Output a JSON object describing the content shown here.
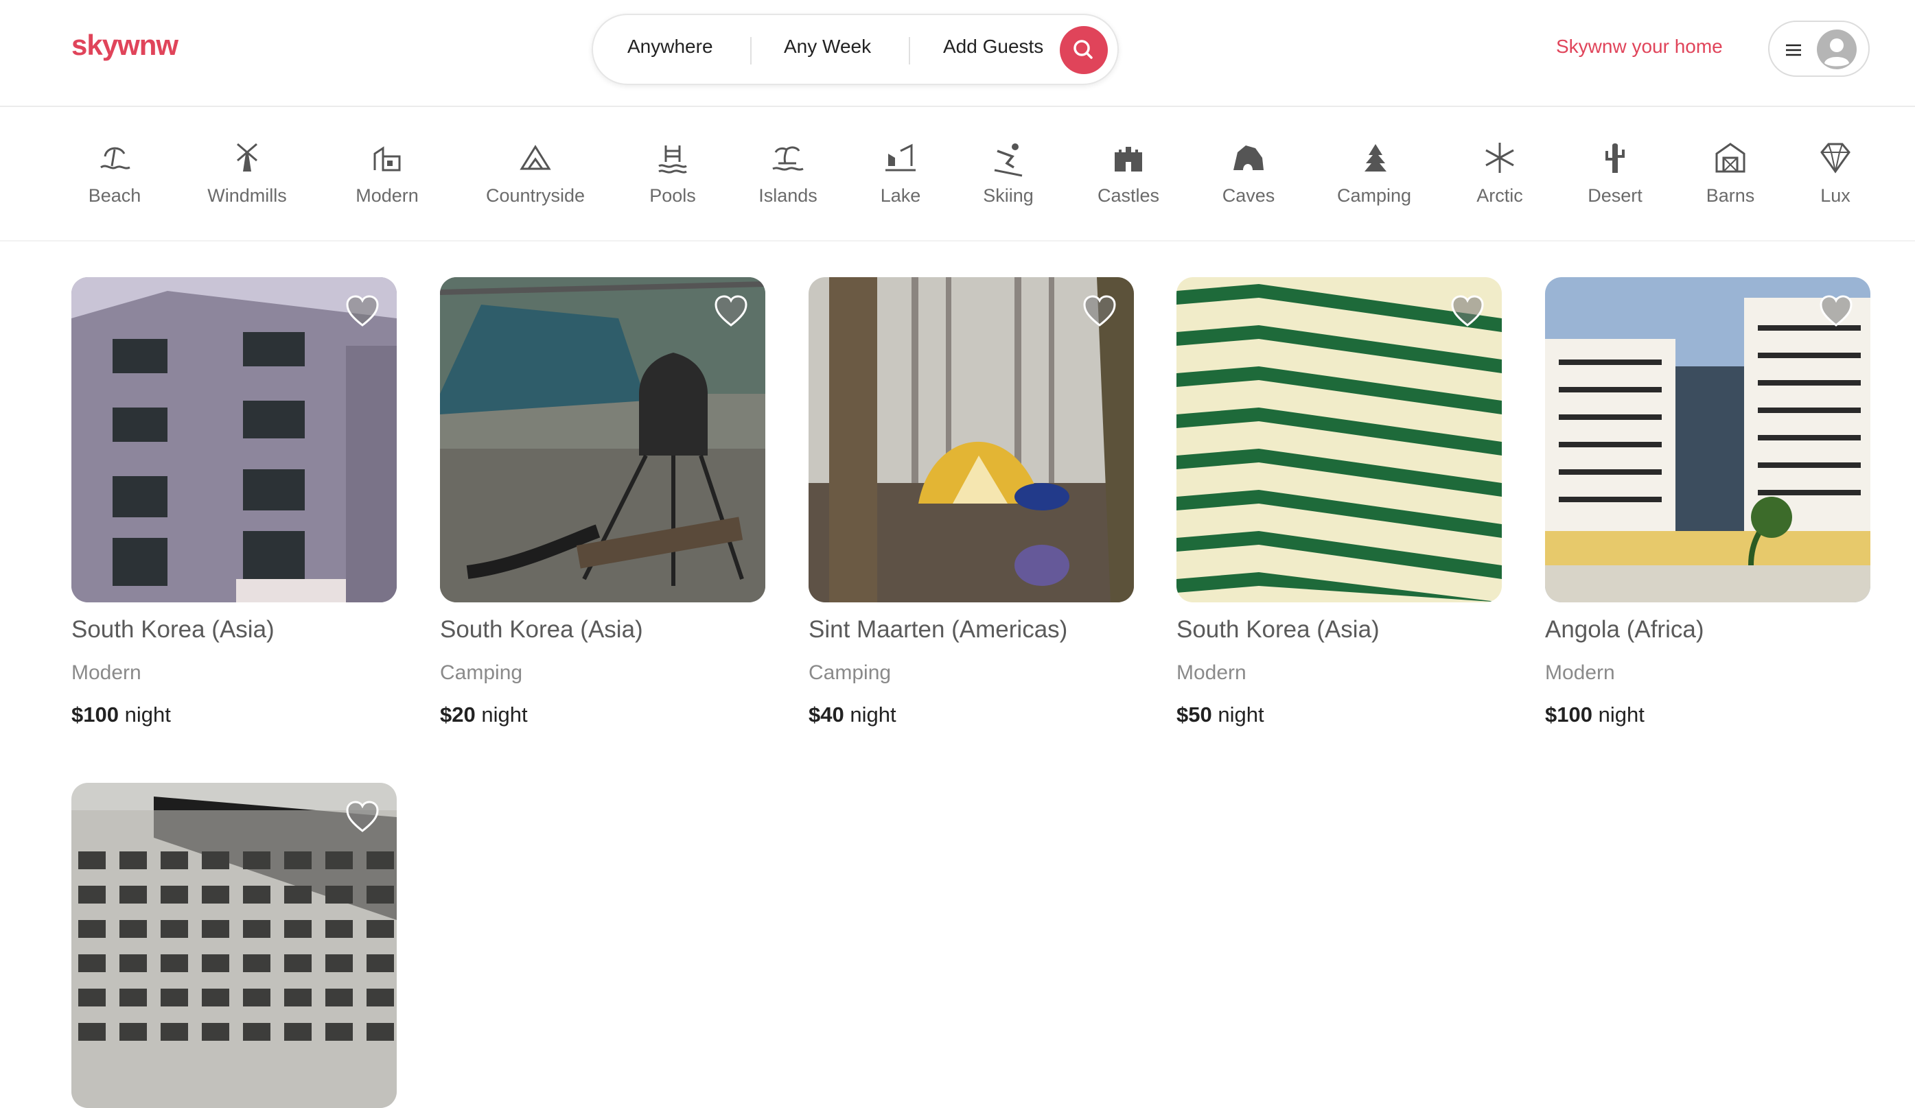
{
  "app": {
    "logo": "skywnw"
  },
  "search": {
    "where": "Anywhere",
    "when": "Any Week",
    "guests": "Add Guests",
    "search_icon": "search-icon"
  },
  "header": {
    "host_link": "Skywnw your home",
    "menu_icon": "hamburger-menu-icon",
    "avatar_icon": "user-avatar-icon"
  },
  "colors": {
    "brand": "#e0445a",
    "muted_text": "#6a6a6a"
  },
  "categories": [
    {
      "label": "Beach",
      "icon": "beach-icon"
    },
    {
      "label": "Windmills",
      "icon": "windmill-icon"
    },
    {
      "label": "Modern",
      "icon": "modern-house-icon"
    },
    {
      "label": "Countryside",
      "icon": "mountain-icon"
    },
    {
      "label": "Pools",
      "icon": "pool-icon"
    },
    {
      "label": "Islands",
      "icon": "island-icon"
    },
    {
      "label": "Lake",
      "icon": "lake-icon"
    },
    {
      "label": "Skiing",
      "icon": "skiing-icon"
    },
    {
      "label": "Castles",
      "icon": "castle-icon"
    },
    {
      "label": "Caves",
      "icon": "cave-icon"
    },
    {
      "label": "Camping",
      "icon": "camping-icon"
    },
    {
      "label": "Arctic",
      "icon": "snowflake-icon"
    },
    {
      "label": "Desert",
      "icon": "cactus-icon"
    },
    {
      "label": "Barns",
      "icon": "barn-icon"
    },
    {
      "label": "Lux",
      "icon": "diamond-icon"
    }
  ],
  "listings": [
    {
      "location": "South Korea (Asia)",
      "category": "Modern",
      "price": "$100",
      "unit": " night"
    },
    {
      "location": "South Korea (Asia)",
      "category": "Camping",
      "price": "$20",
      "unit": " night"
    },
    {
      "location": "Sint Maarten (Americas)",
      "category": "Camping",
      "price": "$40",
      "unit": " night"
    },
    {
      "location": "South Korea (Asia)",
      "category": "Modern",
      "price": "$50",
      "unit": " night"
    },
    {
      "location": "Angola (Africa)",
      "category": "Modern",
      "price": "$100",
      "unit": " night"
    },
    {
      "location": "",
      "category": "",
      "price": "",
      "unit": ""
    }
  ]
}
